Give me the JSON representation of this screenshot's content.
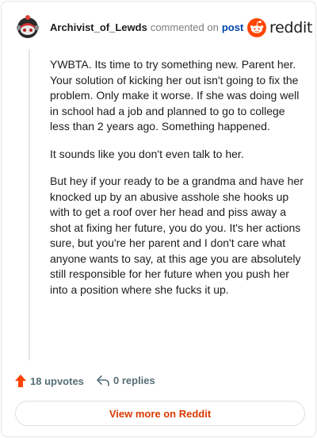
{
  "comment": {
    "author": "Archivist_of_Lewds",
    "action_text": "commented on",
    "post_link": "post",
    "paragraphs": [
      "YWBTA. Its time to try something new. Parent her. Your solution of kicking her out isn't going to fix the problem. Only make it worse. If she was doing well in school had a job and planned to go to college less than 2 years ago. Something happened.",
      "It sounds like you don't even talk to her.",
      "But hey if your ready to be a grandma and have her knocked up by an abusive asshole she hooks up with to get a roof over her head and piss away a shot at fixing her future, you do you. It's her actions sure, but you're her parent and I don't care what anyone wants to say, at this age you are absolutely still responsible for her future when you push her into a position where she fucks it up."
    ]
  },
  "brand": {
    "wordmark": "reddit",
    "color": "#ff4500"
  },
  "stats": {
    "upvotes": "18 upvotes",
    "replies": "0 replies"
  },
  "footer": {
    "view_more": "View more on Reddit"
  }
}
